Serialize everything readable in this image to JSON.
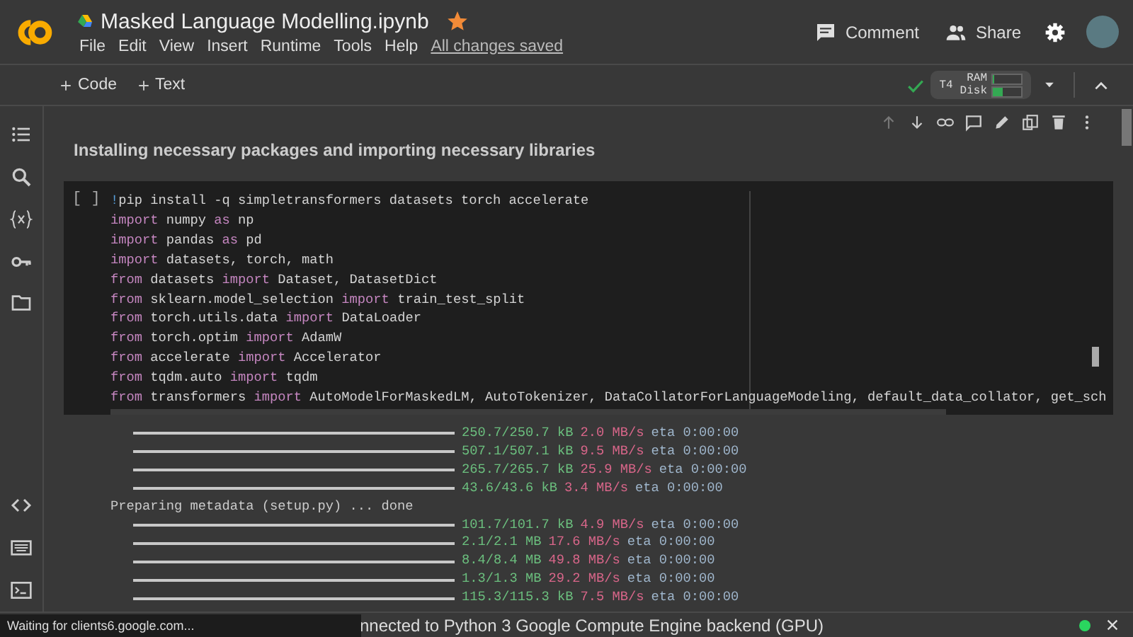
{
  "header": {
    "notebook_title": "Masked Language Modelling.ipynb",
    "starred": true,
    "menu": [
      "File",
      "Edit",
      "View",
      "Insert",
      "Runtime",
      "Tools",
      "Help"
    ],
    "save_status": "All changes saved",
    "actions": [
      {
        "kind": "comment",
        "label": "Comment"
      },
      {
        "kind": "share",
        "label": "Share"
      }
    ]
  },
  "toolbar": {
    "insert_buttons": [
      "Code",
      "Text"
    ],
    "runtime": {
      "connected": true,
      "accelerator": "T4",
      "meters": [
        {
          "label": "RAM",
          "level": 0.05
        },
        {
          "label": "Disk",
          "level": 0.35
        }
      ]
    }
  },
  "section": {
    "heading": "Installing necessary packages and importing necessary libraries"
  },
  "code_cell": {
    "run_marker": "[ ]",
    "lines": [
      [
        {
          "kind": "op",
          "text": "!"
        },
        {
          "kind": "plain",
          "text": "pip install -q simpletransformers datasets torch accelerate"
        }
      ],
      [
        {
          "kind": "kw",
          "text": "import"
        },
        {
          "kind": "plain",
          "text": " numpy "
        },
        {
          "kind": "kw",
          "text": "as"
        },
        {
          "kind": "plain",
          "text": " np"
        }
      ],
      [
        {
          "kind": "kw",
          "text": "import"
        },
        {
          "kind": "plain",
          "text": " pandas "
        },
        {
          "kind": "kw",
          "text": "as"
        },
        {
          "kind": "plain",
          "text": " pd"
        }
      ],
      [
        {
          "kind": "kw",
          "text": "import"
        },
        {
          "kind": "plain",
          "text": " datasets, torch, math"
        }
      ],
      [
        {
          "kind": "kw",
          "text": "from"
        },
        {
          "kind": "plain",
          "text": " datasets "
        },
        {
          "kind": "kw",
          "text": "import"
        },
        {
          "kind": "plain",
          "text": " Dataset, DatasetDict"
        }
      ],
      [
        {
          "kind": "kw",
          "text": "from"
        },
        {
          "kind": "plain",
          "text": " sklearn.model_selection "
        },
        {
          "kind": "kw",
          "text": "import"
        },
        {
          "kind": "plain",
          "text": " train_test_split"
        }
      ],
      [
        {
          "kind": "kw",
          "text": "from"
        },
        {
          "kind": "plain",
          "text": " torch.utils.data "
        },
        {
          "kind": "kw",
          "text": "import"
        },
        {
          "kind": "plain",
          "text": " DataLoader"
        }
      ],
      [
        {
          "kind": "kw",
          "text": "from"
        },
        {
          "kind": "plain",
          "text": " torch.optim "
        },
        {
          "kind": "kw",
          "text": "import"
        },
        {
          "kind": "plain",
          "text": " AdamW"
        }
      ],
      [
        {
          "kind": "kw",
          "text": "from"
        },
        {
          "kind": "plain",
          "text": " accelerate "
        },
        {
          "kind": "kw",
          "text": "import"
        },
        {
          "kind": "plain",
          "text": " Accelerator"
        }
      ],
      [
        {
          "kind": "kw",
          "text": "from"
        },
        {
          "kind": "plain",
          "text": " tqdm.auto "
        },
        {
          "kind": "kw",
          "text": "import"
        },
        {
          "kind": "plain",
          "text": " tqdm"
        }
      ],
      [
        {
          "kind": "kw",
          "text": "from"
        },
        {
          "kind": "plain",
          "text": " transformers "
        },
        {
          "kind": "kw",
          "text": "import"
        },
        {
          "kind": "plain",
          "text": " AutoModelForMaskedLM, AutoTokenizer, DataCollatorForLanguageModeling, default_data_collator, get_sch"
        }
      ]
    ]
  },
  "output": {
    "lines": [
      {
        "kind": "progress",
        "level": 1,
        "size": "250.7/250.7 kB",
        "speed": "2.0 MB/s",
        "eta": "eta 0:00:00"
      },
      {
        "kind": "progress",
        "level": 1,
        "size": "507.1/507.1 kB",
        "speed": "9.5 MB/s",
        "eta": "eta 0:00:00"
      },
      {
        "kind": "progress",
        "level": 1,
        "size": "265.7/265.7 kB",
        "speed": "25.9 MB/s",
        "eta": "eta 0:00:00"
      },
      {
        "kind": "progress",
        "level": 1,
        "size": "43.6/43.6 kB",
        "speed": "3.4 MB/s",
        "eta": "eta 0:00:00"
      },
      {
        "kind": "text",
        "text": "Preparing metadata (setup.py) ... done"
      },
      {
        "kind": "progress",
        "level": 1,
        "size": "101.7/101.7 kB",
        "speed": "4.9 MB/s",
        "eta": "eta 0:00:00"
      },
      {
        "kind": "progress",
        "level": 1,
        "size": "2.1/2.1 MB",
        "speed": "17.6 MB/s",
        "eta": "eta 0:00:00"
      },
      {
        "kind": "progress",
        "level": 1,
        "size": "8.4/8.4 MB",
        "speed": "49.8 MB/s",
        "eta": "eta 0:00:00"
      },
      {
        "kind": "progress",
        "level": 1,
        "size": "1.3/1.3 MB",
        "speed": "29.2 MB/s",
        "eta": "eta 0:00:00"
      },
      {
        "kind": "progress",
        "level": 1,
        "size": "115.3/115.3 kB",
        "speed": "7.5 MB/s",
        "eta": "eta 0:00:00"
      }
    ]
  },
  "status_bar": {
    "message": "nnected to Python 3 Google Compute Engine backend (GPU)",
    "connected": true,
    "tooltip": "Waiting for clients6.google.com..."
  }
}
